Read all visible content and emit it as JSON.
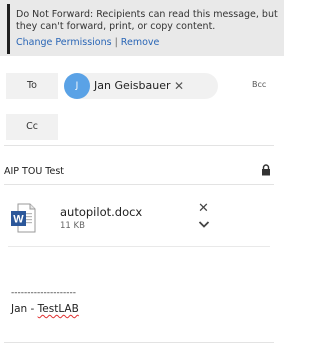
{
  "banner": {
    "message": "Do Not Forward: Recipients can read this message, but they can't forward, print, or copy content.",
    "change_permissions": "Change Permissions",
    "separator": "|",
    "remove": "Remove"
  },
  "recipients": {
    "to_label": "To",
    "to_chip": {
      "initial": "J",
      "name": "Jan Geisbauer",
      "remove_glyph": "✕"
    },
    "bcc_label": "Bcc",
    "cc_label": "Cc"
  },
  "subject": {
    "text": "AIP TOU Test"
  },
  "attachment": {
    "name": "autopilot.docx",
    "size": "11 KB",
    "remove_glyph": "✕"
  },
  "body": {
    "dashes": "--------------------",
    "signature_prefix": "Jan - ",
    "signature_name": "TestLAB"
  },
  "colors": {
    "avatar": "#5aa2e6",
    "link": "#2a66b6",
    "word_blue": "#2b579a"
  },
  "icons": [
    "lock-icon",
    "word-document-icon",
    "remove-attachment-icon",
    "chevron-down-icon"
  ]
}
